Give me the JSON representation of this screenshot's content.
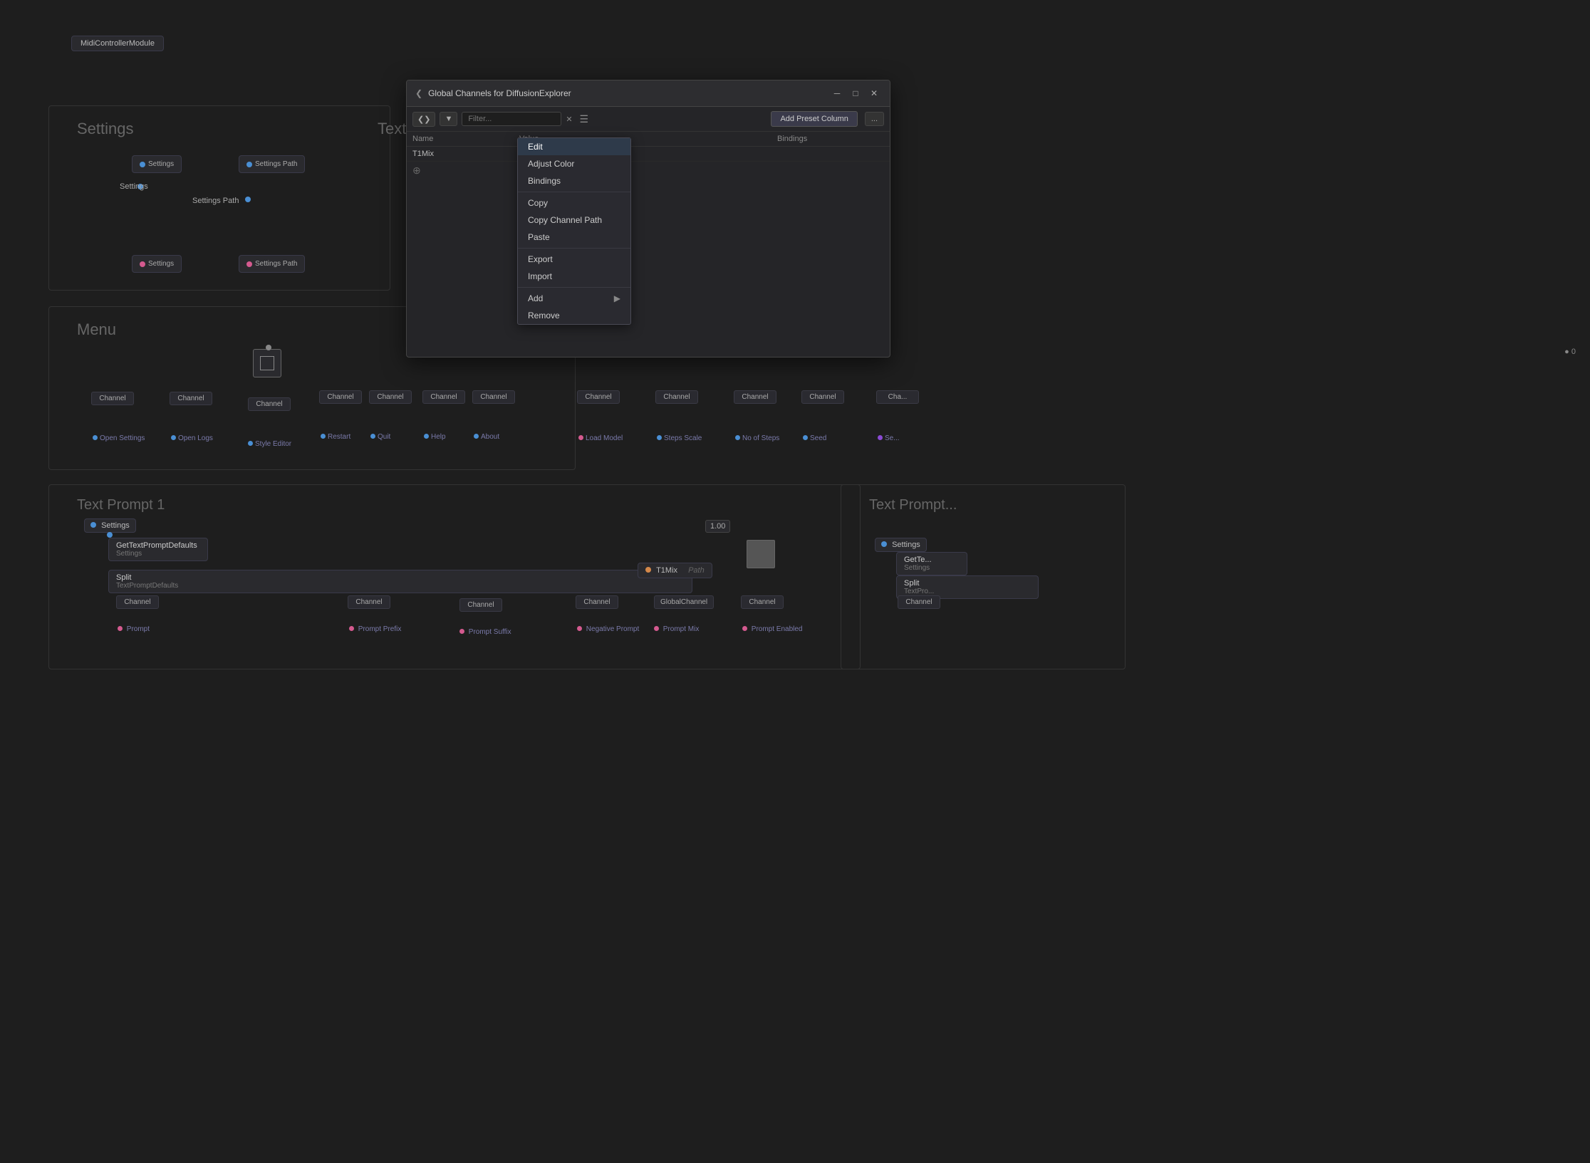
{
  "app": {
    "bg_color": "#1a1a1a"
  },
  "midi_node": {
    "label": "MidiControllerModule"
  },
  "settings_section": {
    "title": "Settings",
    "nodes": [
      {
        "label": "Settings",
        "type": "settings"
      },
      {
        "label": "Settings Path",
        "type": "settings_path"
      },
      {
        "label": "Settings",
        "port": "bottom"
      },
      {
        "label": "Settings Path",
        "port": "bottom"
      }
    ]
  },
  "texture_section": {
    "title": "Textu..."
  },
  "menu_section": {
    "title": "Menu",
    "channels": [
      "Channel",
      "Channel",
      "Channel",
      "Channel",
      "Channel",
      "Channel",
      "Channel"
    ],
    "labels": [
      "Open Settings",
      "Open Logs",
      "Style Editor",
      "Restart",
      "Quit",
      "Help",
      "About"
    ]
  },
  "right_menu_channels": {
    "channels": [
      "Channel",
      "Channel",
      "Channel",
      "Channel",
      "Cha..."
    ],
    "labels": [
      "Load Model",
      "Steps Scale",
      "No of Steps",
      "Seed",
      "Se..."
    ]
  },
  "modal": {
    "title": "Global Channels for DiffusionExplorer",
    "filter_placeholder": "Filter...",
    "columns": [
      "Name",
      "Value",
      "Bindings"
    ],
    "rows": [
      {
        "name": "T1Mix",
        "value": "",
        "bindings": ""
      }
    ],
    "add_preset_btn": "Add Preset Column",
    "more_btn": "..."
  },
  "context_menu": {
    "items": [
      {
        "label": "Edit",
        "highlighted": true
      },
      {
        "label": "Adjust Color"
      },
      {
        "label": "Bindings"
      },
      {
        "label": "Copy"
      },
      {
        "label": "Copy Channel Path"
      },
      {
        "label": "Paste"
      },
      {
        "label": "Export"
      },
      {
        "label": "Import"
      },
      {
        "label": "Add",
        "has_arrow": true
      },
      {
        "label": "Remove"
      }
    ]
  },
  "text_prompt_1": {
    "title": "Text Prompt 1",
    "nodes": [
      {
        "label": "GetTextPromptDefaults",
        "sublabel": "Settings"
      },
      {
        "label": "Split",
        "sublabel": "TextPromptDefaults"
      },
      {
        "label": "Settings",
        "type": "input"
      }
    ],
    "channels": [
      "Channel",
      "Channel",
      "Channel",
      "Channel",
      "GlobalChannel",
      "Channel"
    ],
    "channel_labels": [
      "Prompt",
      "Prompt Prefix",
      "Prompt Suffix",
      "Negative Prompt",
      "Prompt Mix",
      "Prompt Enabled"
    ],
    "t1mix_label": "T1Mix",
    "path_label": "Path",
    "value": "1.00"
  },
  "text_prompt_2": {
    "title": "Text Prompt...",
    "nodes": [
      {
        "label": "GetTe...",
        "sublabel": "Settings"
      }
    ]
  },
  "icons": {
    "collapse": "❮",
    "filter_arrow": "▼",
    "clear_filter": "✕",
    "lines": "☰",
    "minimize": "─",
    "maximize": "□",
    "close": "✕",
    "arrow_right": "▶",
    "plus": "⊕",
    "settings_dot": "●"
  }
}
